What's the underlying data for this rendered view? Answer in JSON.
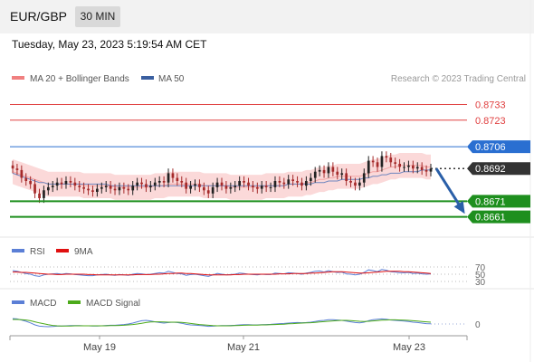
{
  "header": {
    "symbol": "EUR/GBP",
    "interval": "30 MIN",
    "datetime": "Tuesday, May 23, 2023 5:19:54 AM CET"
  },
  "legend": {
    "ma20_label": "MA 20 + Bollinger Bands",
    "ma50_label": "MA 50",
    "ma20_color": "#f08080",
    "ma50_color": "#3a5fa0",
    "credit": "Research © 2023 Trading Central"
  },
  "rsi_legend": {
    "rsi_label": "RSI",
    "ma_label": "9MA",
    "rsi_color": "#5b7fd6",
    "ma_color": "#e01010"
  },
  "macd_legend": {
    "macd_label": "MACD",
    "signal_label": "MACD Signal",
    "macd_color": "#5b7fd6",
    "signal_color": "#4caa1a"
  },
  "colors": {
    "resistance": "#e04040",
    "pivot": "#2a6fd1",
    "support": "#1e8f1e",
    "price_tag": "#333333",
    "arrow": "#2a5fa8",
    "band": "#fbd9d9",
    "up": "#222222",
    "down": "#a52a2a"
  },
  "chart_data": [
    {
      "type": "candlestick",
      "title": "EUR/GBP",
      "x_tick_labels": [
        "May 19",
        "May 21",
        "May 23"
      ],
      "ylim": [
        0.8655,
        0.8742
      ],
      "levels": [
        {
          "value": 0.8733,
          "label": "0.8733",
          "kind": "resistance"
        },
        {
          "value": 0.8723,
          "label": "0.8723",
          "kind": "resistance"
        },
        {
          "value": 0.8706,
          "label": "0.8706",
          "kind": "pivot"
        },
        {
          "value": 0.8692,
          "label": "0.8692",
          "kind": "last"
        },
        {
          "value": 0.8671,
          "label": "0.8671",
          "kind": "support"
        },
        {
          "value": 0.8661,
          "label": "0.8661",
          "kind": "support"
        }
      ],
      "close": [
        0.8692,
        0.8691,
        0.8686,
        0.8684,
        0.8682,
        0.8676,
        0.8673,
        0.8678,
        0.868,
        0.8681,
        0.8683,
        0.8682,
        0.8684,
        0.8683,
        0.8681,
        0.868,
        0.8679,
        0.8678,
        0.8677,
        0.8679,
        0.868,
        0.8681,
        0.8679,
        0.8678,
        0.868,
        0.8679,
        0.8678,
        0.8681,
        0.8683,
        0.8682,
        0.868,
        0.8681,
        0.8683,
        0.8684,
        0.8683,
        0.8689,
        0.8686,
        0.8684,
        0.8683,
        0.8679,
        0.8681,
        0.8682,
        0.868,
        0.8678,
        0.8676,
        0.868,
        0.8683,
        0.8681,
        0.8679,
        0.868,
        0.8681,
        0.8684,
        0.8683,
        0.8681,
        0.868,
        0.8679,
        0.8681,
        0.868,
        0.868,
        0.8684,
        0.8683,
        0.8682,
        0.8685,
        0.8684,
        0.8683,
        0.8681,
        0.8684,
        0.8686,
        0.869,
        0.8691,
        0.8689,
        0.8693,
        0.869,
        0.8688,
        0.8689,
        0.8684,
        0.8683,
        0.8681,
        0.8683,
        0.8689,
        0.8697,
        0.8696,
        0.8693,
        0.87,
        0.8699,
        0.8696,
        0.8695,
        0.8693,
        0.8693,
        0.8694,
        0.8692,
        0.8693,
        0.8691,
        0.869,
        0.8692
      ],
      "ma20": [
        0.869,
        0.8689,
        0.8688,
        0.8687,
        0.8686,
        0.8685,
        0.8684,
        0.8683,
        0.8682,
        0.8682,
        0.8682,
        0.8682,
        0.8682,
        0.8682,
        0.8682,
        0.8682,
        0.8681,
        0.8681,
        0.8681,
        0.8681,
        0.8681,
        0.8681,
        0.8681,
        0.868,
        0.868,
        0.868,
        0.868,
        0.868,
        0.868,
        0.868,
        0.868,
        0.868,
        0.8681,
        0.8681,
        0.8681,
        0.8682,
        0.8682,
        0.8682,
        0.8682,
        0.8682,
        0.8682,
        0.8682,
        0.8682,
        0.8681,
        0.8681,
        0.8681,
        0.8681,
        0.8681,
        0.8681,
        0.868,
        0.868,
        0.868,
        0.868,
        0.868,
        0.868,
        0.868,
        0.868,
        0.8681,
        0.8681,
        0.8681,
        0.8681,
        0.8681,
        0.8682,
        0.8682,
        0.8682,
        0.8682,
        0.8683,
        0.8683,
        0.8684,
        0.8685,
        0.8685,
        0.8686,
        0.8686,
        0.8687,
        0.8687,
        0.8687,
        0.8687,
        0.8687,
        0.8687,
        0.8688,
        0.8689,
        0.869,
        0.869,
        0.8691,
        0.8692,
        0.8693,
        0.8693,
        0.8694,
        0.8694,
        0.8694,
        0.8694,
        0.8694,
        0.8694,
        0.8693,
        0.8693
      ],
      "bb_width": 0.0008,
      "ma50": [
        0.8689,
        0.8688,
        0.8687,
        0.8686,
        0.8685,
        0.8684,
        0.8683,
        0.8683,
        0.8682,
        0.8682,
        0.8682,
        0.8682,
        0.8682,
        0.8682,
        0.8682,
        0.8682,
        0.8682,
        0.8682,
        0.8682,
        0.8682,
        0.8682,
        0.8682,
        0.8681,
        0.8681,
        0.8681,
        0.8681,
        0.8681,
        0.8681,
        0.8681,
        0.8681,
        0.8681,
        0.8681,
        0.8681,
        0.8681,
        0.8681,
        0.8681,
        0.8681,
        0.8681,
        0.8681,
        0.8681,
        0.8681,
        0.8681,
        0.8681,
        0.8681,
        0.8681,
        0.8681,
        0.8681,
        0.8681,
        0.8681,
        0.8681,
        0.8681,
        0.8681,
        0.8681,
        0.8681,
        0.8681,
        0.8681,
        0.8681,
        0.8681,
        0.8681,
        0.8681,
        0.8681,
        0.8681,
        0.8682,
        0.8682,
        0.8682,
        0.8682,
        0.8682,
        0.8682,
        0.8683,
        0.8683,
        0.8683,
        0.8684,
        0.8684,
        0.8684,
        0.8685,
        0.8685,
        0.8685,
        0.8685,
        0.8685,
        0.8686,
        0.8686,
        0.8687,
        0.8687,
        0.8688,
        0.8688,
        0.8689,
        0.8689,
        0.8689,
        0.869,
        0.869,
        0.869,
        0.869,
        0.8691,
        0.8691,
        0.8691
      ],
      "forecast": {
        "from": 0.8692,
        "to": 0.8661
      }
    },
    {
      "type": "line",
      "title": "RSI",
      "y_tick_labels": [
        "70",
        "50",
        "30"
      ],
      "levels": [
        70,
        50,
        30
      ],
      "ylim": [
        20,
        80
      ],
      "series": [
        {
          "name": "RSI",
          "values": [
            60,
            58,
            55,
            52,
            50,
            46,
            44,
            48,
            50,
            51,
            52,
            50,
            52,
            51,
            49,
            48,
            47,
            46,
            46,
            48,
            49,
            50,
            48,
            47,
            49,
            48,
            47,
            50,
            52,
            51,
            49,
            50,
            52,
            54,
            53,
            58,
            55,
            52,
            51,
            47,
            49,
            50,
            48,
            46,
            44,
            48,
            52,
            50,
            48,
            49,
            50,
            53,
            52,
            50,
            49,
            48,
            50,
            49,
            49,
            53,
            52,
            51,
            54,
            53,
            52,
            50,
            53,
            55,
            58,
            59,
            56,
            60,
            57,
            55,
            56,
            51,
            50,
            48,
            50,
            55,
            62,
            60,
            57,
            63,
            61,
            57,
            56,
            54,
            54,
            55,
            52,
            53,
            51,
            50,
            51
          ]
        },
        {
          "name": "9MA",
          "values": [
            56,
            56,
            55,
            55,
            54,
            53,
            52,
            51,
            50,
            50,
            49,
            49,
            50,
            50,
            50,
            50,
            50,
            49,
            49,
            48,
            48,
            48,
            48,
            48,
            48,
            48,
            48,
            48,
            49,
            49,
            49,
            49,
            50,
            50,
            51,
            52,
            52,
            53,
            53,
            52,
            52,
            51,
            50,
            49,
            48,
            48,
            48,
            48,
            48,
            48,
            49,
            49,
            50,
            50,
            50,
            50,
            50,
            50,
            50,
            50,
            51,
            51,
            51,
            52,
            52,
            52,
            52,
            53,
            53,
            54,
            55,
            56,
            57,
            57,
            57,
            56,
            55,
            54,
            53,
            53,
            54,
            55,
            56,
            57,
            58,
            58,
            58,
            58,
            57,
            57,
            56,
            55,
            54,
            53,
            52
          ]
        }
      ]
    },
    {
      "type": "line",
      "title": "MACD",
      "y_tick_labels": [
        "0"
      ],
      "ylim": [
        -1,
        1
      ],
      "series": [
        {
          "name": "MACD",
          "values": [
            0.3,
            0.28,
            0.22,
            0.15,
            0.06,
            -0.05,
            -0.12,
            -0.14,
            -0.15,
            -0.14,
            -0.12,
            -0.11,
            -0.1,
            -0.09,
            -0.09,
            -0.09,
            -0.1,
            -0.1,
            -0.11,
            -0.11,
            -0.1,
            -0.08,
            -0.07,
            -0.07,
            -0.05,
            -0.03,
            0.0,
            0.05,
            0.12,
            0.18,
            0.2,
            0.17,
            0.12,
            0.08,
            0.05,
            0.08,
            0.1,
            0.08,
            0.04,
            -0.02,
            -0.05,
            -0.06,
            -0.08,
            -0.1,
            -0.13,
            -0.12,
            -0.1,
            -0.09,
            -0.09,
            -0.08,
            -0.07,
            -0.05,
            -0.04,
            -0.04,
            -0.05,
            -0.05,
            -0.04,
            -0.03,
            -0.02,
            0.0,
            0.02,
            0.03,
            0.05,
            0.07,
            0.08,
            0.07,
            0.08,
            0.1,
            0.14,
            0.18,
            0.2,
            0.24,
            0.24,
            0.22,
            0.2,
            0.16,
            0.12,
            0.08,
            0.06,
            0.1,
            0.18,
            0.24,
            0.26,
            0.28,
            0.26,
            0.22,
            0.2,
            0.18,
            0.16,
            0.14,
            0.1,
            0.08,
            0.05,
            0.02,
            0.01
          ]
        },
        {
          "name": "MACD Signal",
          "values": [
            0.25,
            0.25,
            0.24,
            0.22,
            0.18,
            0.12,
            0.06,
            0.01,
            -0.04,
            -0.08,
            -0.1,
            -0.11,
            -0.11,
            -0.11,
            -0.1,
            -0.1,
            -0.1,
            -0.1,
            -0.1,
            -0.1,
            -0.1,
            -0.1,
            -0.09,
            -0.09,
            -0.08,
            -0.07,
            -0.05,
            -0.03,
            0.0,
            0.04,
            0.08,
            0.11,
            0.12,
            0.12,
            0.11,
            0.1,
            0.1,
            0.1,
            0.09,
            0.06,
            0.03,
            0.0,
            -0.03,
            -0.05,
            -0.07,
            -0.09,
            -0.1,
            -0.1,
            -0.1,
            -0.1,
            -0.09,
            -0.08,
            -0.07,
            -0.06,
            -0.06,
            -0.06,
            -0.05,
            -0.05,
            -0.04,
            -0.03,
            -0.02,
            -0.01,
            0.01,
            0.02,
            0.04,
            0.05,
            0.06,
            0.07,
            0.09,
            0.11,
            0.13,
            0.15,
            0.17,
            0.19,
            0.2,
            0.2,
            0.19,
            0.17,
            0.15,
            0.14,
            0.15,
            0.17,
            0.19,
            0.21,
            0.22,
            0.23,
            0.23,
            0.22,
            0.21,
            0.2,
            0.18,
            0.16,
            0.14,
            0.12,
            0.1
          ]
        }
      ]
    }
  ]
}
